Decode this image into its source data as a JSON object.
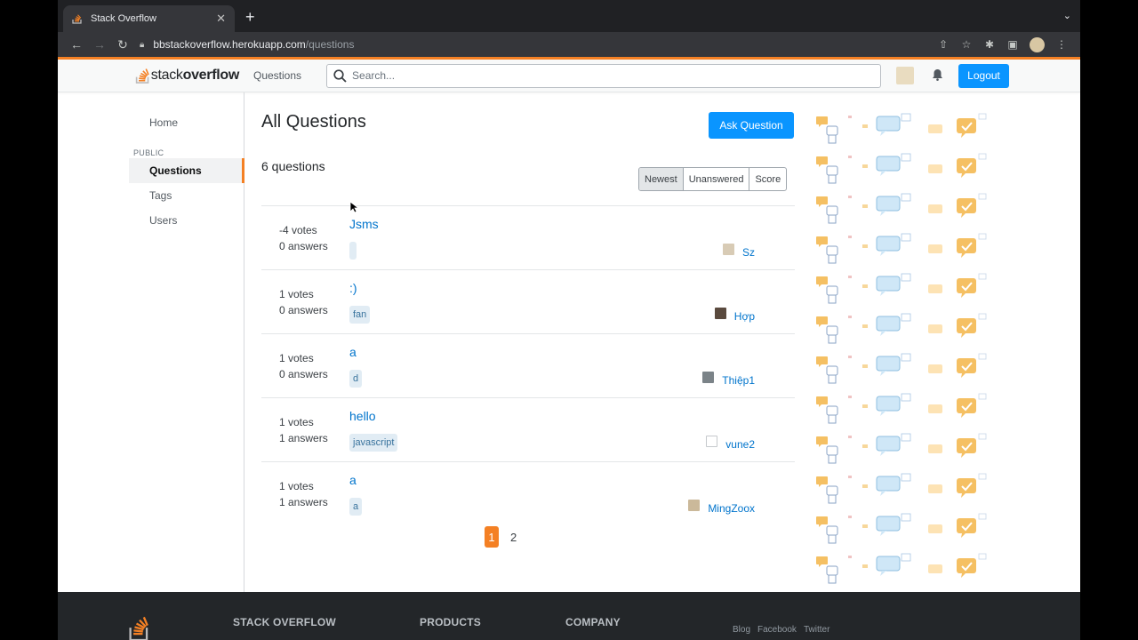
{
  "browser": {
    "tab_title": "Stack Overflow",
    "url_domain": "bbstackoverflow.herokuapp.com",
    "url_path": "/questions"
  },
  "header": {
    "logo_text_light": "stack",
    "logo_text_bold": "overflow",
    "nav_questions": "Questions",
    "search_placeholder": "Search...",
    "logout_label": "Logout"
  },
  "sidebar": {
    "home": "Home",
    "section": "PUBLIC",
    "questions": "Questions",
    "tags": "Tags",
    "users": "Users"
  },
  "main": {
    "title": "All Questions",
    "ask_button": "Ask Question",
    "count": "6 questions",
    "filters": [
      "Newest",
      "Unanswered",
      "Score"
    ],
    "questions": [
      {
        "votes": "-4 votes",
        "answers": "0 answers",
        "title": "Jsms",
        "tag": "",
        "user": "Sz"
      },
      {
        "votes": "1 votes",
        "answers": "0 answers",
        "title": ":)",
        "tag": "fan",
        "user": "Hợp"
      },
      {
        "votes": "1 votes",
        "answers": "0 answers",
        "title": "a",
        "tag": "d",
        "user": "Thiệp1"
      },
      {
        "votes": "1 votes",
        "answers": "1 answers",
        "title": "hello",
        "tag": "javascript",
        "user": "vune2"
      },
      {
        "votes": "1 votes",
        "answers": "1 answers",
        "title": "a",
        "tag": "a",
        "user": "MingZoox"
      }
    ],
    "pages": [
      "1",
      "2"
    ]
  },
  "footer": {
    "col1": "STACK OVERFLOW",
    "col2": "PRODUCTS",
    "col3": "COMPANY",
    "links": [
      "Blog",
      "Facebook",
      "Twitter"
    ]
  },
  "colors": {
    "accent": "#f48024",
    "primary": "#0a95ff",
    "link": "#0074cc"
  }
}
